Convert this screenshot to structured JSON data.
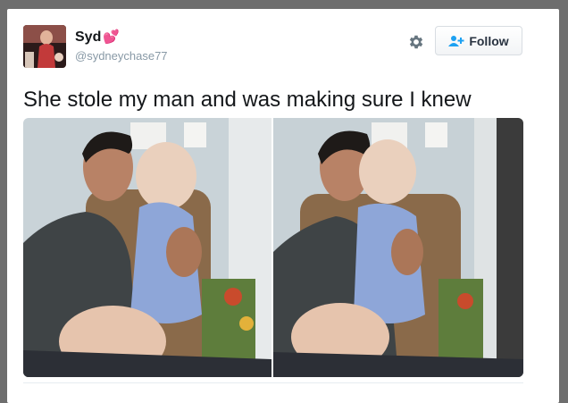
{
  "tweet": {
    "display_name": "Syd",
    "name_emoji": "💕",
    "handle": "@sydneychase77",
    "text": "She stole my man and was making sure I knew"
  },
  "actions": {
    "settings_icon": "gear-icon",
    "follow_icon": "add-person-icon",
    "follow_label": "Follow"
  },
  "media": {
    "photos": [
      {
        "index": 1,
        "subject": "man holding baby looking at him"
      },
      {
        "index": 2,
        "subject": "man holding smiling baby"
      }
    ]
  },
  "colors": {
    "text": "#14171a",
    "handle": "#8899a6",
    "heart": "#e0245e",
    "follow_text": "#293341",
    "follow_icon": "#1da1f2"
  }
}
